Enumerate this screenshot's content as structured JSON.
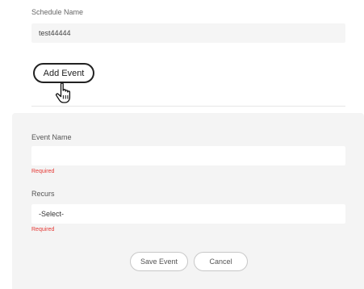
{
  "schedule": {
    "label": "Schedule Name",
    "value": "test44444"
  },
  "add_event_label": "Add Event",
  "cursor_icon": "hand-pointer-icon",
  "event_form": {
    "event_name_label": "Event Name",
    "event_name_value": "",
    "event_name_error": "Required",
    "recurs_label": "Recurs",
    "recurs_selected": "-Select-",
    "recurs_error": "Required",
    "save_label": "Save Event",
    "cancel_label": "Cancel"
  },
  "colors": {
    "error": "#e53935",
    "panel_background": "#f4f4f4",
    "input_background": "#f5f5f5"
  }
}
